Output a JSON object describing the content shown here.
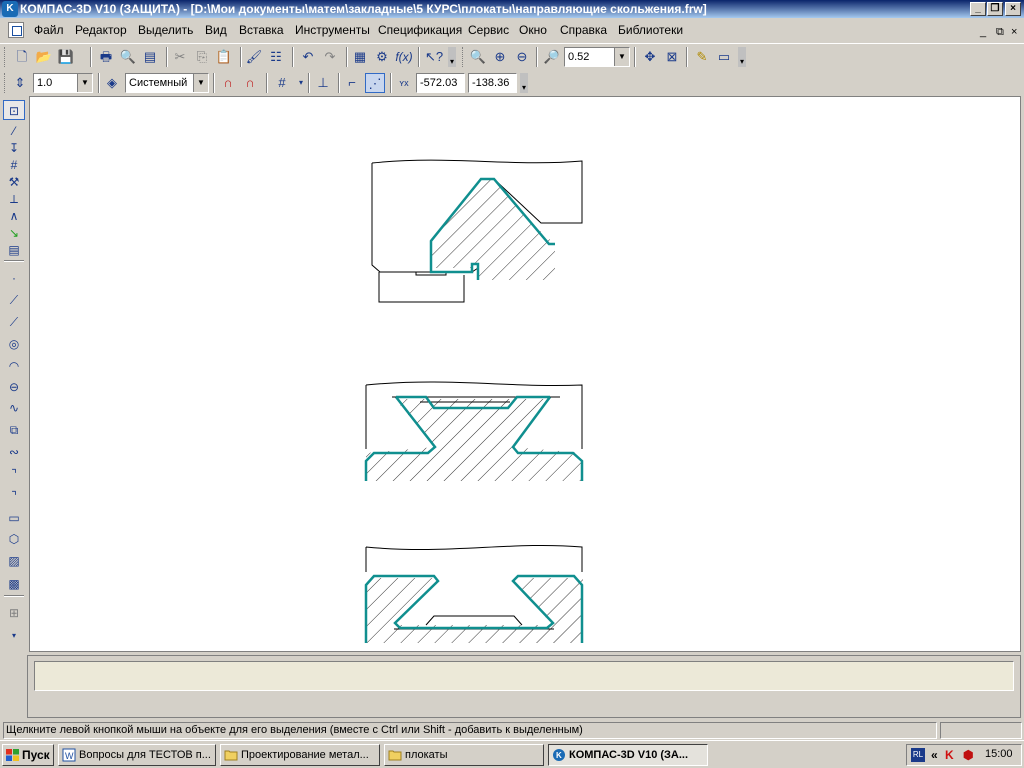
{
  "window": {
    "title": "КОМПАС-3D V10 (ЗАЩИТА) - [D:\\Мои документы\\матем\\закладные\\5 КУРС\\плокаты\\направляющие скольжения.frw]",
    "app_icon": "kompas-logo-icon",
    "controls": [
      "minimize",
      "restore",
      "close"
    ]
  },
  "menu": {
    "items": [
      "Файл",
      "Редактор",
      "Выделить",
      "Вид",
      "Вставка",
      "Инструменты",
      "Спецификация",
      "Сервис",
      "Окно",
      "Справка",
      "Библиотеки"
    ],
    "mdi_controls": [
      "_",
      "⧉",
      "×"
    ]
  },
  "toolbar_standard": {
    "zoom_value": "0.52",
    "icons": [
      "new-document-icon",
      "open-folder-icon",
      "save-icon",
      "print-icon",
      "print-preview-icon",
      "export-icon",
      "cut-icon",
      "copy-icon",
      "paste-icon",
      "format-brush-icon",
      "properties-icon",
      "undo-icon",
      "redo-icon",
      "manager-icon",
      "variables-icon",
      "fx-icon",
      "help-icon",
      "zoom-in-window-icon",
      "zoom-in-icon",
      "zoom-out-icon",
      "zoom-scale-icon",
      "pan-icon",
      "fit-all-icon",
      "refresh-icon",
      "layers-icon"
    ]
  },
  "toolbar_current_state": {
    "step_value": "1.0",
    "layer_style": "Системный",
    "x_coordinate": "-572.03",
    "y_coordinate": "-138.36",
    "icons": [
      "step-icon",
      "layer-icon",
      "snap-magnet-icon",
      "snap-local-icon",
      "grid-icon",
      "local-cs-icon",
      "ortho-icon",
      "round-icon"
    ]
  },
  "palette": {
    "icons": [
      "select-icon",
      "geometry-icon",
      "dimensions-icon",
      "symbols-icon",
      "editing-icon",
      "parameterization-icon",
      "measure-icon",
      "selection-icon",
      "associative-views-icon",
      "spec-icon",
      "point-icon",
      "line-icon",
      "segment-icon",
      "circle-icon",
      "arc-icon",
      "ellipse-icon",
      "spline-icon",
      "polyline-icon",
      "bezier-icon",
      "chamfer-icon",
      "fillet-icon",
      "rectangle-icon",
      "polygon-icon",
      "hatch-icon",
      "fill-icon",
      "macro-icon"
    ]
  },
  "status": {
    "message": "Щелкните левой кнопкой мыши на объекте для его выделения (вместе с Ctrl или Shift - добавить к выделенным)"
  },
  "taskbar": {
    "start_label": "Пуск",
    "tasks": [
      {
        "label": "Вопросы для ТЕСТОВ п...",
        "icon": "word-document-icon",
        "active": false
      },
      {
        "label": "Проектирование метал...",
        "icon": "folder-icon",
        "active": false
      },
      {
        "label": "плокаты",
        "icon": "folder-icon",
        "active": false
      },
      {
        "label": "КОМПАС-3D V10 (ЗА...",
        "icon": "kompas-logo-icon",
        "active": true
      }
    ],
    "language": "RL",
    "clock": "15:00"
  },
  "colors": {
    "contour": "#108f8f",
    "thin_line": "#000000",
    "canvas_bg": "#ffffff",
    "titlebar_start": "#0a246a",
    "titlebar_end": "#a6caf0"
  }
}
